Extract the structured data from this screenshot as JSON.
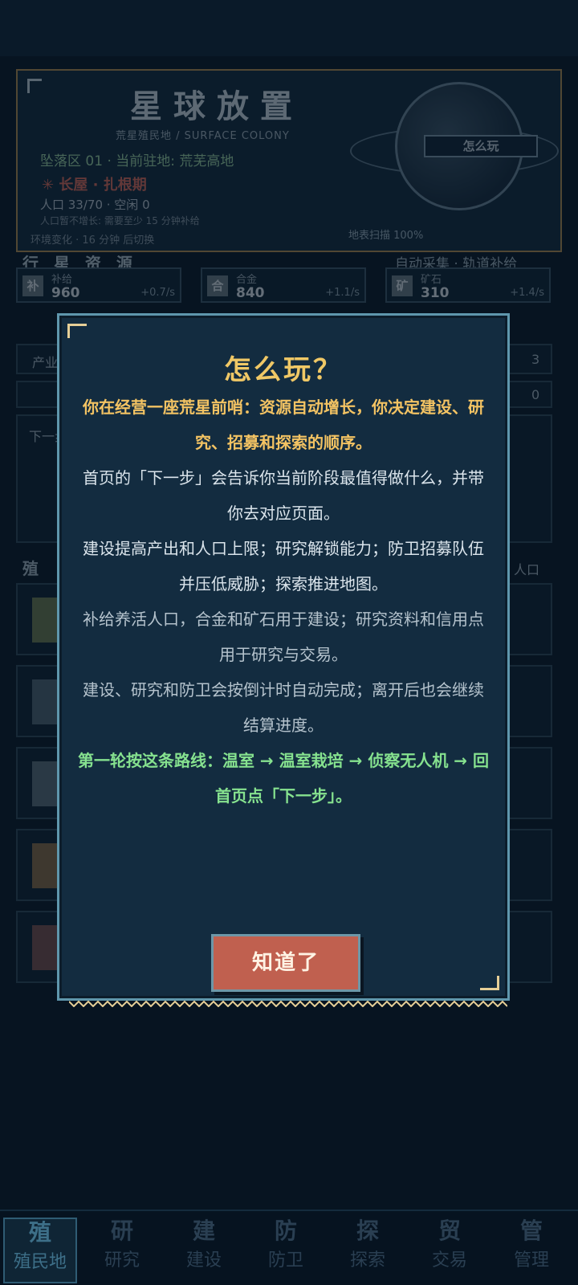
{
  "hero": {
    "title": "星球放置",
    "subtitle": "荒星殖民地 / SURFACE COLONY",
    "location": "坠落区 01 · 当前驻地: 荒芜高地",
    "era": "✳ 长屋 · 扎根期",
    "population": "人口 33/70 · 空闲 0",
    "population_note": "人口暂不增长: 需要至少 15 分钟补给",
    "environment": "环境变化 · 16 分钟 后切换",
    "scan": "地表扫描 100%",
    "how_button": "怎么玩"
  },
  "resources": {
    "heading": "行 星 资 源",
    "auto_note": "自动采集 · 轨道补给",
    "items": [
      {
        "icon": "补",
        "name": "补给",
        "value": "960",
        "rate": "+0.7/s"
      },
      {
        "icon": "合",
        "name": "合金",
        "value": "840",
        "rate": "+1.1/s"
      },
      {
        "icon": "矿",
        "name": "矿石",
        "value": "310",
        "rate": "+1.4/s"
      }
    ]
  },
  "background_rows": {
    "industry": "产业",
    "colony_heading": "殖",
    "next_step": "下一步",
    "pop_label": "人口",
    "count_a": "3",
    "count_b": "0"
  },
  "modal": {
    "title": "怎么玩？",
    "lines": [
      {
        "text": "你在经营一座荒星前哨：资源自动增长，你决定建设、研究、招募和探索的顺序。",
        "style": "hl"
      },
      {
        "text": "首页的「下一步」会告诉你当前阶段最值得做什么，并带你去对应页面。",
        "style": "normal"
      },
      {
        "text": "建设提高产出和人口上限；研究解锁能力；防卫招募队伍并压低威胁；探索推进地图。",
        "style": "normal"
      },
      {
        "text": "补给养活人口，合金和矿石用于建设；研究资料和信用点用于研究与交易。",
        "style": "dim"
      },
      {
        "text": "建设、研究和防卫会按倒计时自动完成；离开后也会继续结算进度。",
        "style": "dim"
      },
      {
        "text": "第一轮按这条路线：温室 → 温室栽培 → 侦察无人机 → 回首页点「下一步」。",
        "style": "route"
      }
    ],
    "ok_button": "知道了"
  },
  "nav": [
    {
      "glyph": "殖",
      "label": "殖民地",
      "active": true
    },
    {
      "glyph": "研",
      "label": "研究",
      "active": false
    },
    {
      "glyph": "建",
      "label": "建设",
      "active": false
    },
    {
      "glyph": "防",
      "label": "防卫",
      "active": false
    },
    {
      "glyph": "探",
      "label": "探索",
      "active": false
    },
    {
      "glyph": "贸",
      "label": "交易",
      "active": false
    },
    {
      "glyph": "管",
      "label": "管理",
      "active": false
    }
  ],
  "colors": {
    "background": "#071421",
    "modal_bg": "#132c40",
    "modal_border": "#5f97ad",
    "title_gold": "#f0c866",
    "route_green": "#86e28f",
    "button_red": "#c0604f"
  }
}
